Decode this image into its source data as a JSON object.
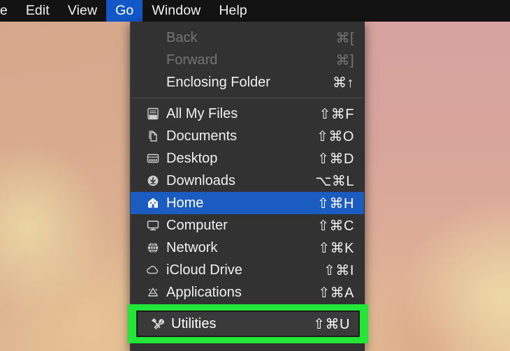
{
  "menubar": {
    "items": [
      {
        "label": "ile",
        "active": false,
        "truncated": true
      },
      {
        "label": "Edit",
        "active": false
      },
      {
        "label": "View",
        "active": false
      },
      {
        "label": "Go",
        "active": true
      },
      {
        "label": "Window",
        "active": false
      },
      {
        "label": "Help",
        "active": false
      }
    ],
    "background_color": "#131313",
    "active_color": "#1258c8"
  },
  "go_menu": {
    "background_color": "#323232",
    "selected_color": "#1a5cc0",
    "disabled_color": "#757575",
    "groups": [
      {
        "items": [
          {
            "label": "Back",
            "shortcut": "⌘[",
            "icon": "none",
            "state": "disabled"
          },
          {
            "label": "Forward",
            "shortcut": "⌘]",
            "icon": "none",
            "state": "disabled"
          },
          {
            "label": "Enclosing Folder",
            "shortcut": "⌘↑",
            "icon": "none",
            "state": "enabled"
          }
        ]
      },
      {
        "items": [
          {
            "label": "All My Files",
            "shortcut": "⇧⌘F",
            "icon": "all-my-files-icon",
            "state": "enabled"
          },
          {
            "label": "Documents",
            "shortcut": "⇧⌘O",
            "icon": "documents-icon",
            "state": "enabled"
          },
          {
            "label": "Desktop",
            "shortcut": "⇧⌘D",
            "icon": "desktop-icon",
            "state": "enabled"
          },
          {
            "label": "Downloads",
            "shortcut": "⌥⌘L",
            "icon": "downloads-icon",
            "state": "enabled"
          },
          {
            "label": "Home",
            "shortcut": "⇧⌘H",
            "icon": "home-icon",
            "state": "selected"
          },
          {
            "label": "Computer",
            "shortcut": "⇧⌘C",
            "icon": "computer-icon",
            "state": "enabled"
          },
          {
            "label": "Network",
            "shortcut": "⇧⌘K",
            "icon": "network-icon",
            "state": "enabled"
          },
          {
            "label": "iCloud Drive",
            "shortcut": "⇧⌘I",
            "icon": "icloud-icon",
            "state": "enabled"
          },
          {
            "label": "Applications",
            "shortcut": "⇧⌘A",
            "icon": "applications-icon",
            "state": "enabled"
          },
          {
            "label": "Utilities",
            "shortcut": "⇧⌘U",
            "icon": "utilities-icon",
            "state": "enabled"
          }
        ]
      }
    ]
  },
  "annotation": {
    "highlight_color": "#22e638",
    "target_label": "Utilities",
    "target_shortcut": "⇧⌘U",
    "target_icon": "utilities-icon"
  }
}
